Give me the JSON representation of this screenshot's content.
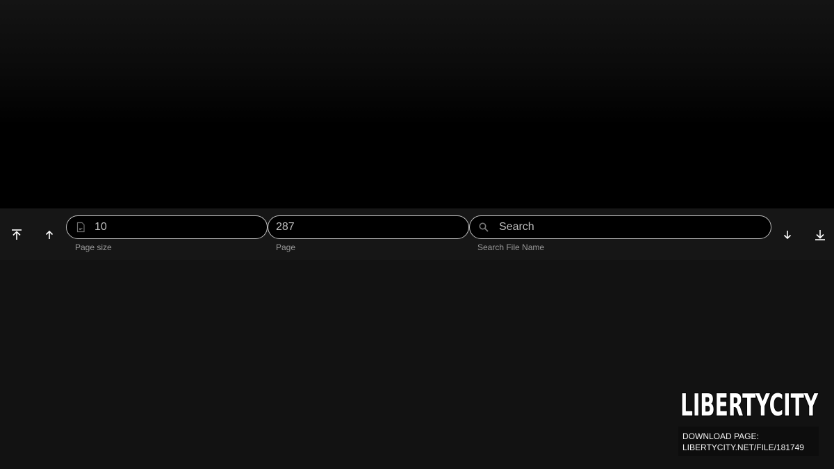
{
  "toolbar": {
    "page_size": {
      "value": "10",
      "helper": "Page size",
      "icon": "document-icon"
    },
    "page": {
      "value": "287",
      "helper": "Page"
    },
    "search": {
      "placeholder": "Search",
      "helper": "Search File Name",
      "icon": "search-icon"
    },
    "buttons": {
      "first": "arrow-to-top-icon",
      "prev": "arrow-up-icon",
      "next": "arrow-down-icon",
      "last": "arrow-to-bottom-icon"
    }
  },
  "watermark": {
    "logo_text": "LIBERTYCITY",
    "download_line1": "DOWNLOAD PAGE:",
    "download_line2": "LIBERTYCITY.NET/FILE/181749"
  },
  "colors": {
    "background": "#121212",
    "toolbar": "#161616",
    "field_border": "#bdbdbd",
    "helper_text": "#9a9a9a"
  }
}
